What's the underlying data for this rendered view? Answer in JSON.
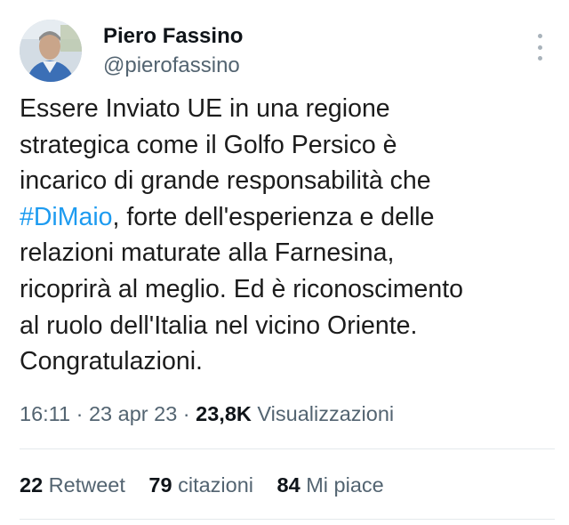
{
  "author": {
    "name": "Piero Fassino",
    "handle": "@pierofassino",
    "avatar_icon": "profile-photo"
  },
  "more_icon": "three-dots-vertical-icon",
  "tweet": {
    "lines": [
      "Essere Inviato UE in una regione",
      "strategica come il Golfo Persico è",
      "incarico di grande responsabilità che",
      "#DiMaio",
      ", forte dell'esperienza e delle",
      "relazioni maturate alla Farnesina,",
      "ricoprirà al meglio. Ed è riconoscimento",
      "al ruolo dell'Italia nel vicino Oriente.",
      "Congratulazioni."
    ],
    "hashtag_color": "#1d9bf0"
  },
  "meta": {
    "time": "16:11",
    "sep1": " · ",
    "date": "23 apr 23",
    "sep2": " · ",
    "views_count": "23,8K",
    "views_label": " Visualizzazioni"
  },
  "stats": [
    {
      "count": "22",
      "label": " Retweet"
    },
    {
      "count": "79",
      "label": " citazioni"
    },
    {
      "count": "84",
      "label": " Mi piace"
    }
  ]
}
